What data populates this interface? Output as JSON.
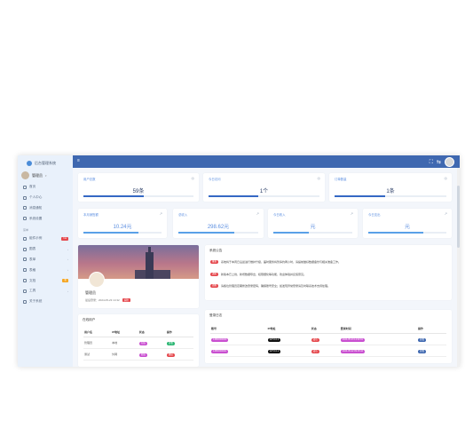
{
  "app": {
    "logo_text": "后台管理系统",
    "colors": {
      "primary": "#3f68b0",
      "accent": "#5b8ee0",
      "danger": "#e5484d"
    }
  },
  "user": {
    "name": "管理员"
  },
  "sidebar": {
    "top_items": [
      {
        "icon": "home-icon",
        "label": "首页"
      },
      {
        "icon": "user-icon",
        "label": "个人中心"
      },
      {
        "icon": "message-icon",
        "label": "消息通知"
      },
      {
        "icon": "setting-icon",
        "label": "系统设置"
      }
    ],
    "group_title": "菜单",
    "group_items": [
      {
        "icon": "grid-icon",
        "label": "组件示例",
        "badge": "hot"
      },
      {
        "icon": "chart-icon",
        "label": "图表",
        "arrow": "›"
      },
      {
        "icon": "form-icon",
        "label": "表单",
        "arrow": "›"
      },
      {
        "icon": "table-icon",
        "label": "表格",
        "arrow": "›"
      },
      {
        "icon": "doc-icon",
        "label": "文档",
        "badge": "新"
      },
      {
        "icon": "tool-icon",
        "label": "工具",
        "arrow": "›"
      },
      {
        "icon": "info-icon",
        "label": "关于系统"
      }
    ]
  },
  "topbar": {
    "icons": [
      "fullscreen-icon",
      "translate-icon"
    ]
  },
  "stats_big": [
    {
      "label": "用户总数",
      "value": "59条",
      "progress": 0.55
    },
    {
      "label": "今日访问",
      "value": "1个",
      "progress": 0.45
    },
    {
      "label": "订单数量",
      "value": "1条",
      "progress": 0.45
    }
  ],
  "stats_small": [
    {
      "label": "本月销售额",
      "value": "10.24元",
      "progress": 0.7
    },
    {
      "label": "总收入",
      "value": "298.62元",
      "progress": 0.7
    },
    {
      "label": "今日收入",
      "value": "元",
      "progress": 0.45
    },
    {
      "label": "今日支出",
      "value": "元",
      "progress": 0.7
    }
  ],
  "profile": {
    "name": "管理员",
    "info": "最后登录：2024-05-23 14:32",
    "tag": "超管"
  },
  "notice": {
    "title": "系统公告",
    "items": [
      {
        "tag": "重要",
        "tag_color": "#e5484d",
        "text": "系统将于本周日凌晨进行维护升级，届时服务将暂停约两小时，请提前做好数据备份与相关准备工作。"
      },
      {
        "tag": "通知",
        "tag_color": "#e5484d",
        "text": "新版本已上线，新增数据导出、权限细化等功能，欢迎体验并反馈意见。"
      },
      {
        "tag": "提醒",
        "tag_color": "#e5484d",
        "text": "请各位管理员定期修改登录密码，确保账号安全；如发现异常登录请及时联系技术支持处理。"
      }
    ]
  },
  "left_table": {
    "title": "在线用户",
    "headers": [
      "用户名",
      "IP地址",
      "状态",
      "操作"
    ],
    "rows": [
      {
        "c1": "管理员",
        "c2": "本地",
        "s": "在线",
        "s_color": "#c94fd0",
        "o": "查看",
        "o_color": "#2bb673"
      },
      {
        "c1": "测试",
        "c2": "外网",
        "s": "离线",
        "s_color": "#c94fd0",
        "o": "踢出",
        "o_color": "#e5484d"
      }
    ]
  },
  "right_table": {
    "title": "登录日志",
    "headers": [
      "账号",
      "IP地址",
      "状态",
      "登录时间",
      "操作"
    ],
    "rows": [
      {
        "a": "13800000000",
        "b": "127.0.0.1",
        "c": "成功",
        "d": "2024-05-23 14:32:01",
        "e": "查看"
      },
      {
        "a": "13800000001",
        "b": "127.0.0.1",
        "c": "成功",
        "d": "2024-05-22 09:15:44",
        "e": "查看"
      }
    ]
  }
}
